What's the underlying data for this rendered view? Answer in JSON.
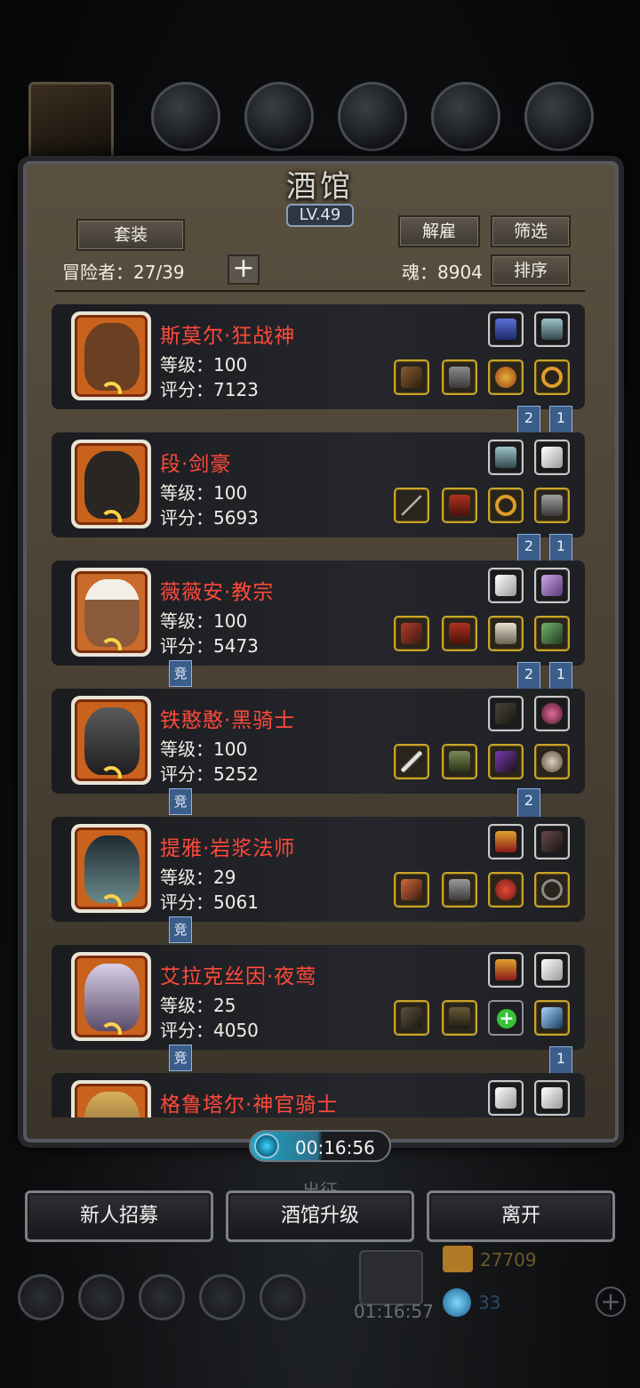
{
  "panel": {
    "title": "酒馆",
    "level": "LV.49",
    "suit_button": "套装",
    "dismiss_button": "解雇",
    "filter_button": "筛选",
    "sort_button": "排序",
    "adventurers_label": "冒险者：27/39",
    "soul_label": "魂：8904"
  },
  "heroes": [
    {
      "name": "斯莫尔·狂战神",
      "level": "等级：100",
      "score": "评分：7123",
      "top_slots": [
        "necklace-icon",
        "wing-charm-icon"
      ],
      "bottom_slots": [
        "axe-icon",
        "armor-icon",
        "medallion-icon",
        "ring-icon"
      ],
      "flags": [
        "2",
        "1"
      ],
      "comp_flag": ""
    },
    {
      "name": "段·剑豪",
      "level": "等级：100",
      "score": "评分：5693",
      "top_slots": [
        "wing-charm-icon",
        "feather-icon"
      ],
      "bottom_slots": [
        "spear-icon",
        "cloak-icon",
        "ring-icon",
        "gauntlet-icon"
      ],
      "flags": [
        "2",
        "1"
      ],
      "comp_flag": ""
    },
    {
      "name": "薇薇安·教宗",
      "level": "等级：100",
      "score": "评分：5473",
      "top_slots": [
        "feather-icon",
        "crystal-icon"
      ],
      "bottom_slots": [
        "hammer-icon",
        "cloak-icon",
        "gauntlet-icon",
        "claw-icon"
      ],
      "flags": [
        "2",
        "1"
      ],
      "comp_flag": "竞"
    },
    {
      "name": "铁憨憨·黑骑士",
      "level": "等级：100",
      "score": "评分：5252",
      "top_slots": [
        "bow-icon",
        "orb-icon"
      ],
      "bottom_slots": [
        "sword-icon",
        "armor-icon",
        "rune-icon",
        "shield-icon"
      ],
      "flags": [
        "2"
      ],
      "comp_flag": "竞"
    },
    {
      "name": "提雅·岩浆法师",
      "level": "等级：29",
      "score": "评分：5061",
      "top_slots": [
        "crest-icon",
        "quill-icon"
      ],
      "bottom_slots": [
        "staff-icon",
        "armor-icon",
        "gem-ring-icon",
        "amulet-icon"
      ],
      "flags": [],
      "comp_flag": "竞"
    },
    {
      "name": "艾拉克丝因·夜莺",
      "level": "等级：25",
      "score": "评分：4050",
      "top_slots": [
        "crest-icon",
        "feather-icon"
      ],
      "bottom_slots": [
        "scythe-icon",
        "robe-icon",
        "add-slot-icon",
        "dagger-icon"
      ],
      "flags": [
        "1"
      ],
      "comp_flag": "竞"
    },
    {
      "name": "格鲁塔尔·神官骑士",
      "level": "",
      "score": "",
      "top_slots": [
        "feather-icon",
        "feather-icon"
      ],
      "bottom_slots": [],
      "flags": [],
      "comp_flag": ""
    }
  ],
  "timer": "00:16:56",
  "actions": {
    "recruit": "新人招募",
    "upgrade": "酒馆升级",
    "leave": "离开"
  },
  "background": {
    "gold_amount": "27709",
    "gem_amount": "33",
    "gift_timer": "01:16:57",
    "dim_label": "出征"
  }
}
